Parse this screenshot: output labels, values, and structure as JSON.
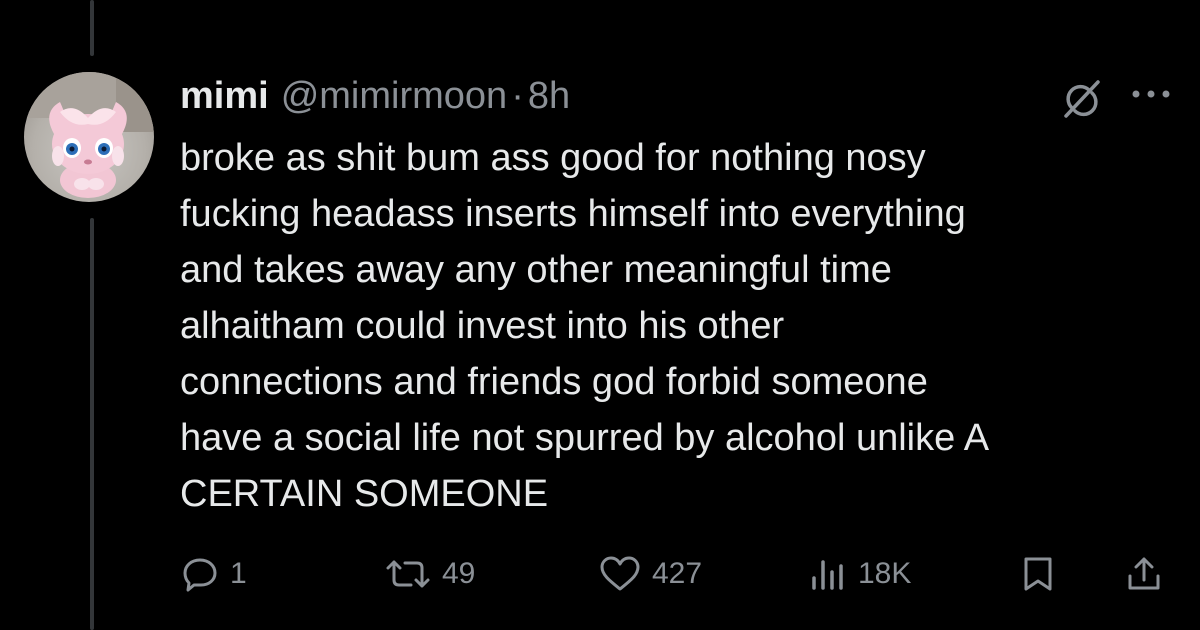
{
  "tweet": {
    "display_name": "mimi",
    "handle": "@mimirmoon",
    "separator": "·",
    "time": "8h",
    "text_lines": [
      "broke as shit bum ass good for nothing nosy",
      "fucking headass inserts himself into everything",
      "and takes away any other meaningful time",
      "alhaitham could invest into his other",
      "connections and friends god forbid someone",
      "have a social life not spurred by alcohol unlike A",
      "CERTAIN SOMEONE"
    ]
  },
  "actions": {
    "replies": "1",
    "reposts": "49",
    "likes": "427",
    "views": "18K"
  },
  "icons": {
    "avatar": "espurr-avatar",
    "grok": "grok-icon",
    "more": "more-icon",
    "reply": "reply-icon",
    "repost": "repost-icon",
    "like": "heart-icon",
    "views": "views-icon",
    "bookmark": "bookmark-icon",
    "share": "share-icon"
  },
  "colors": {
    "background": "#000000",
    "text": "#e7e9ea",
    "muted": "#8b9096",
    "thread_line": "#333639"
  }
}
